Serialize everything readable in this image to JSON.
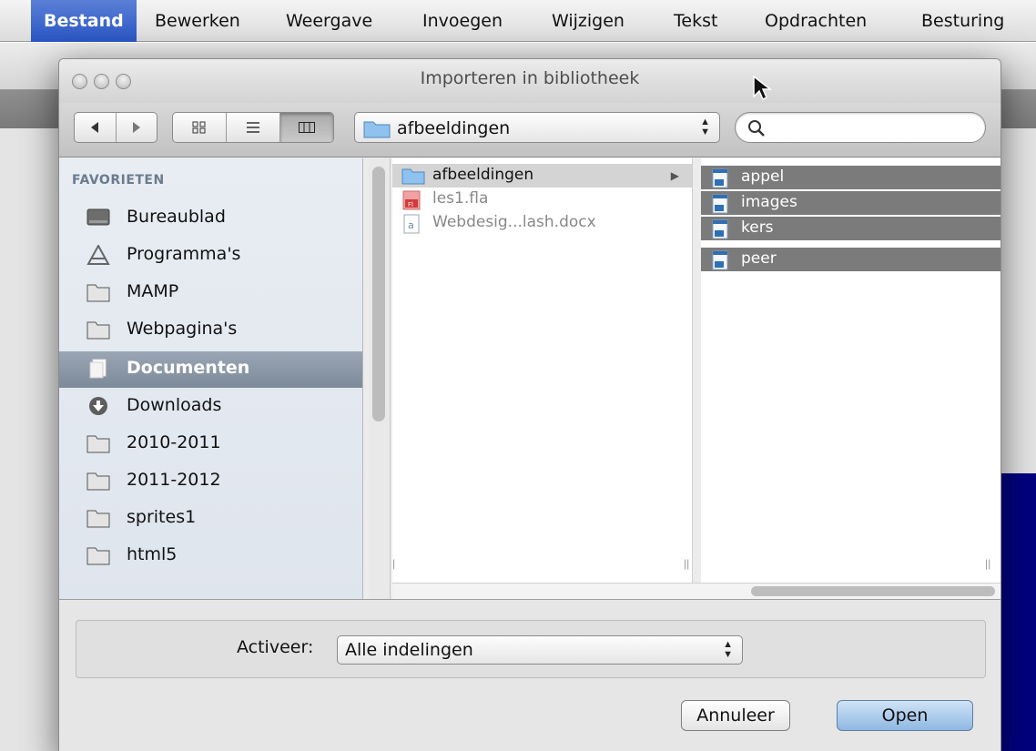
{
  "menubar": {
    "items": [
      "Bestand",
      "Bewerken",
      "Weergave",
      "Invoegen",
      "Wijzigen",
      "Tekst",
      "Opdrachten",
      "Besturing"
    ],
    "active": "Bestand"
  },
  "dialog": {
    "title": "Importeren in bibliotheek",
    "toolbar": {
      "back_icon": "back-arrow-icon",
      "forward_icon": "forward-arrow-icon",
      "view_modes": [
        "icon-view",
        "list-view",
        "column-view"
      ],
      "active_view": "column-view",
      "current_folder": "afbeeldingen",
      "search_placeholder": ""
    },
    "sidebar": {
      "heading": "FAVORIETEN",
      "items": [
        {
          "label": "Bureaublad",
          "icon": "desktop-icon"
        },
        {
          "label": "Programma's",
          "icon": "applications-icon"
        },
        {
          "label": "MAMP",
          "icon": "folder-icon"
        },
        {
          "label": "Webpagina's",
          "icon": "folder-icon"
        },
        {
          "label": "Documenten",
          "icon": "documents-icon",
          "selected": true
        },
        {
          "label": "Downloads",
          "icon": "downloads-icon"
        },
        {
          "label": "2010-2011",
          "icon": "folder-icon"
        },
        {
          "label": "2011-2012",
          "icon": "folder-icon"
        },
        {
          "label": "sprites1",
          "icon": "folder-icon"
        },
        {
          "label": "html5",
          "icon": "folder-icon"
        }
      ]
    },
    "column1": [
      {
        "label": "afbeeldingen",
        "icon": "folder-icon",
        "selected": true,
        "has_children": true
      },
      {
        "label": "les1.fla",
        "icon": "flash-file-icon",
        "dimmed": true
      },
      {
        "label": "Webdesig...lash.docx",
        "icon": "word-document-icon",
        "dimmed": true
      }
    ],
    "column2": [
      {
        "label": "appel",
        "icon": "image-file-icon",
        "selected": true
      },
      {
        "label": "images",
        "icon": "image-file-icon",
        "selected": true
      },
      {
        "label": "kers",
        "icon": "image-file-icon",
        "selected": true
      },
      {
        "label": "peer",
        "icon": "image-file-icon",
        "selected": true
      }
    ],
    "format": {
      "label": "Activeer:",
      "value": "Alle indelingen"
    },
    "buttons": {
      "cancel": "Annuleer",
      "open": "Open"
    }
  },
  "colors": {
    "menu_highlight": "#2a56c4",
    "sidebar_selection": "#7d8a99",
    "file_selection": "#7b7b7b",
    "folder_blue": "#8fc2ee",
    "stage_navy": "#000080"
  }
}
